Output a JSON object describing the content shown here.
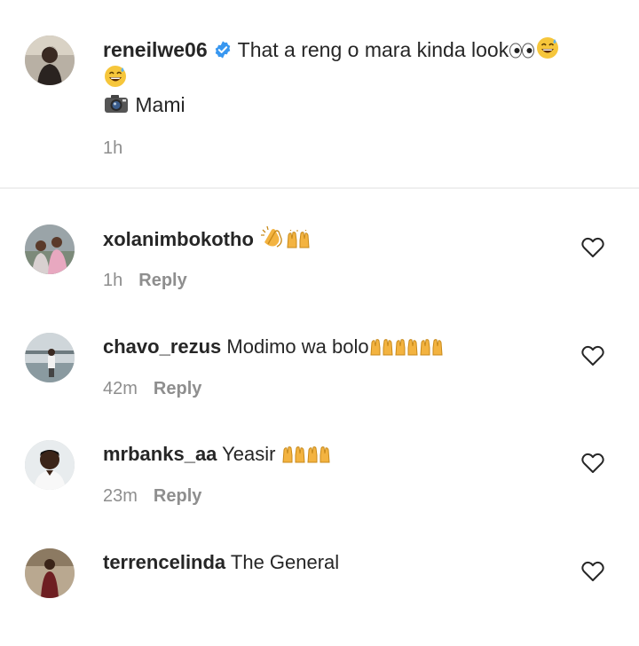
{
  "caption": {
    "username": "reneilwe06",
    "text": "That a reng o mara kinda look",
    "line2_label": "Mami",
    "time": "1h",
    "icons": [
      "verified-badge-icon",
      "eyes-emoji",
      "grinning-sweat-emoji",
      "camera-emoji"
    ]
  },
  "comments": [
    {
      "username": "xolanimbokotho",
      "text": "",
      "emojis": [
        "clapping-hands-emoji",
        "raising-hands-emoji"
      ],
      "time": "1h",
      "reply_label": "Reply"
    },
    {
      "username": "chavo_rezus",
      "text": "Modimo wa bolo",
      "emojis": [
        "raising-hands-emoji",
        "raising-hands-emoji",
        "raising-hands-emoji"
      ],
      "time": "42m",
      "reply_label": "Reply"
    },
    {
      "username": "mrbanks_aa",
      "text": "Yeasir",
      "emojis": [
        "raising-hands-emoji",
        "raising-hands-emoji"
      ],
      "time": "23m",
      "reply_label": "Reply"
    },
    {
      "username": "terrencelinda",
      "text": "The General",
      "emojis": [],
      "time": "",
      "reply_label": ""
    }
  ],
  "colors": {
    "verified": "#3897f0",
    "muted": "#8e8e8e",
    "text": "#262626",
    "divider": "#efefef"
  }
}
